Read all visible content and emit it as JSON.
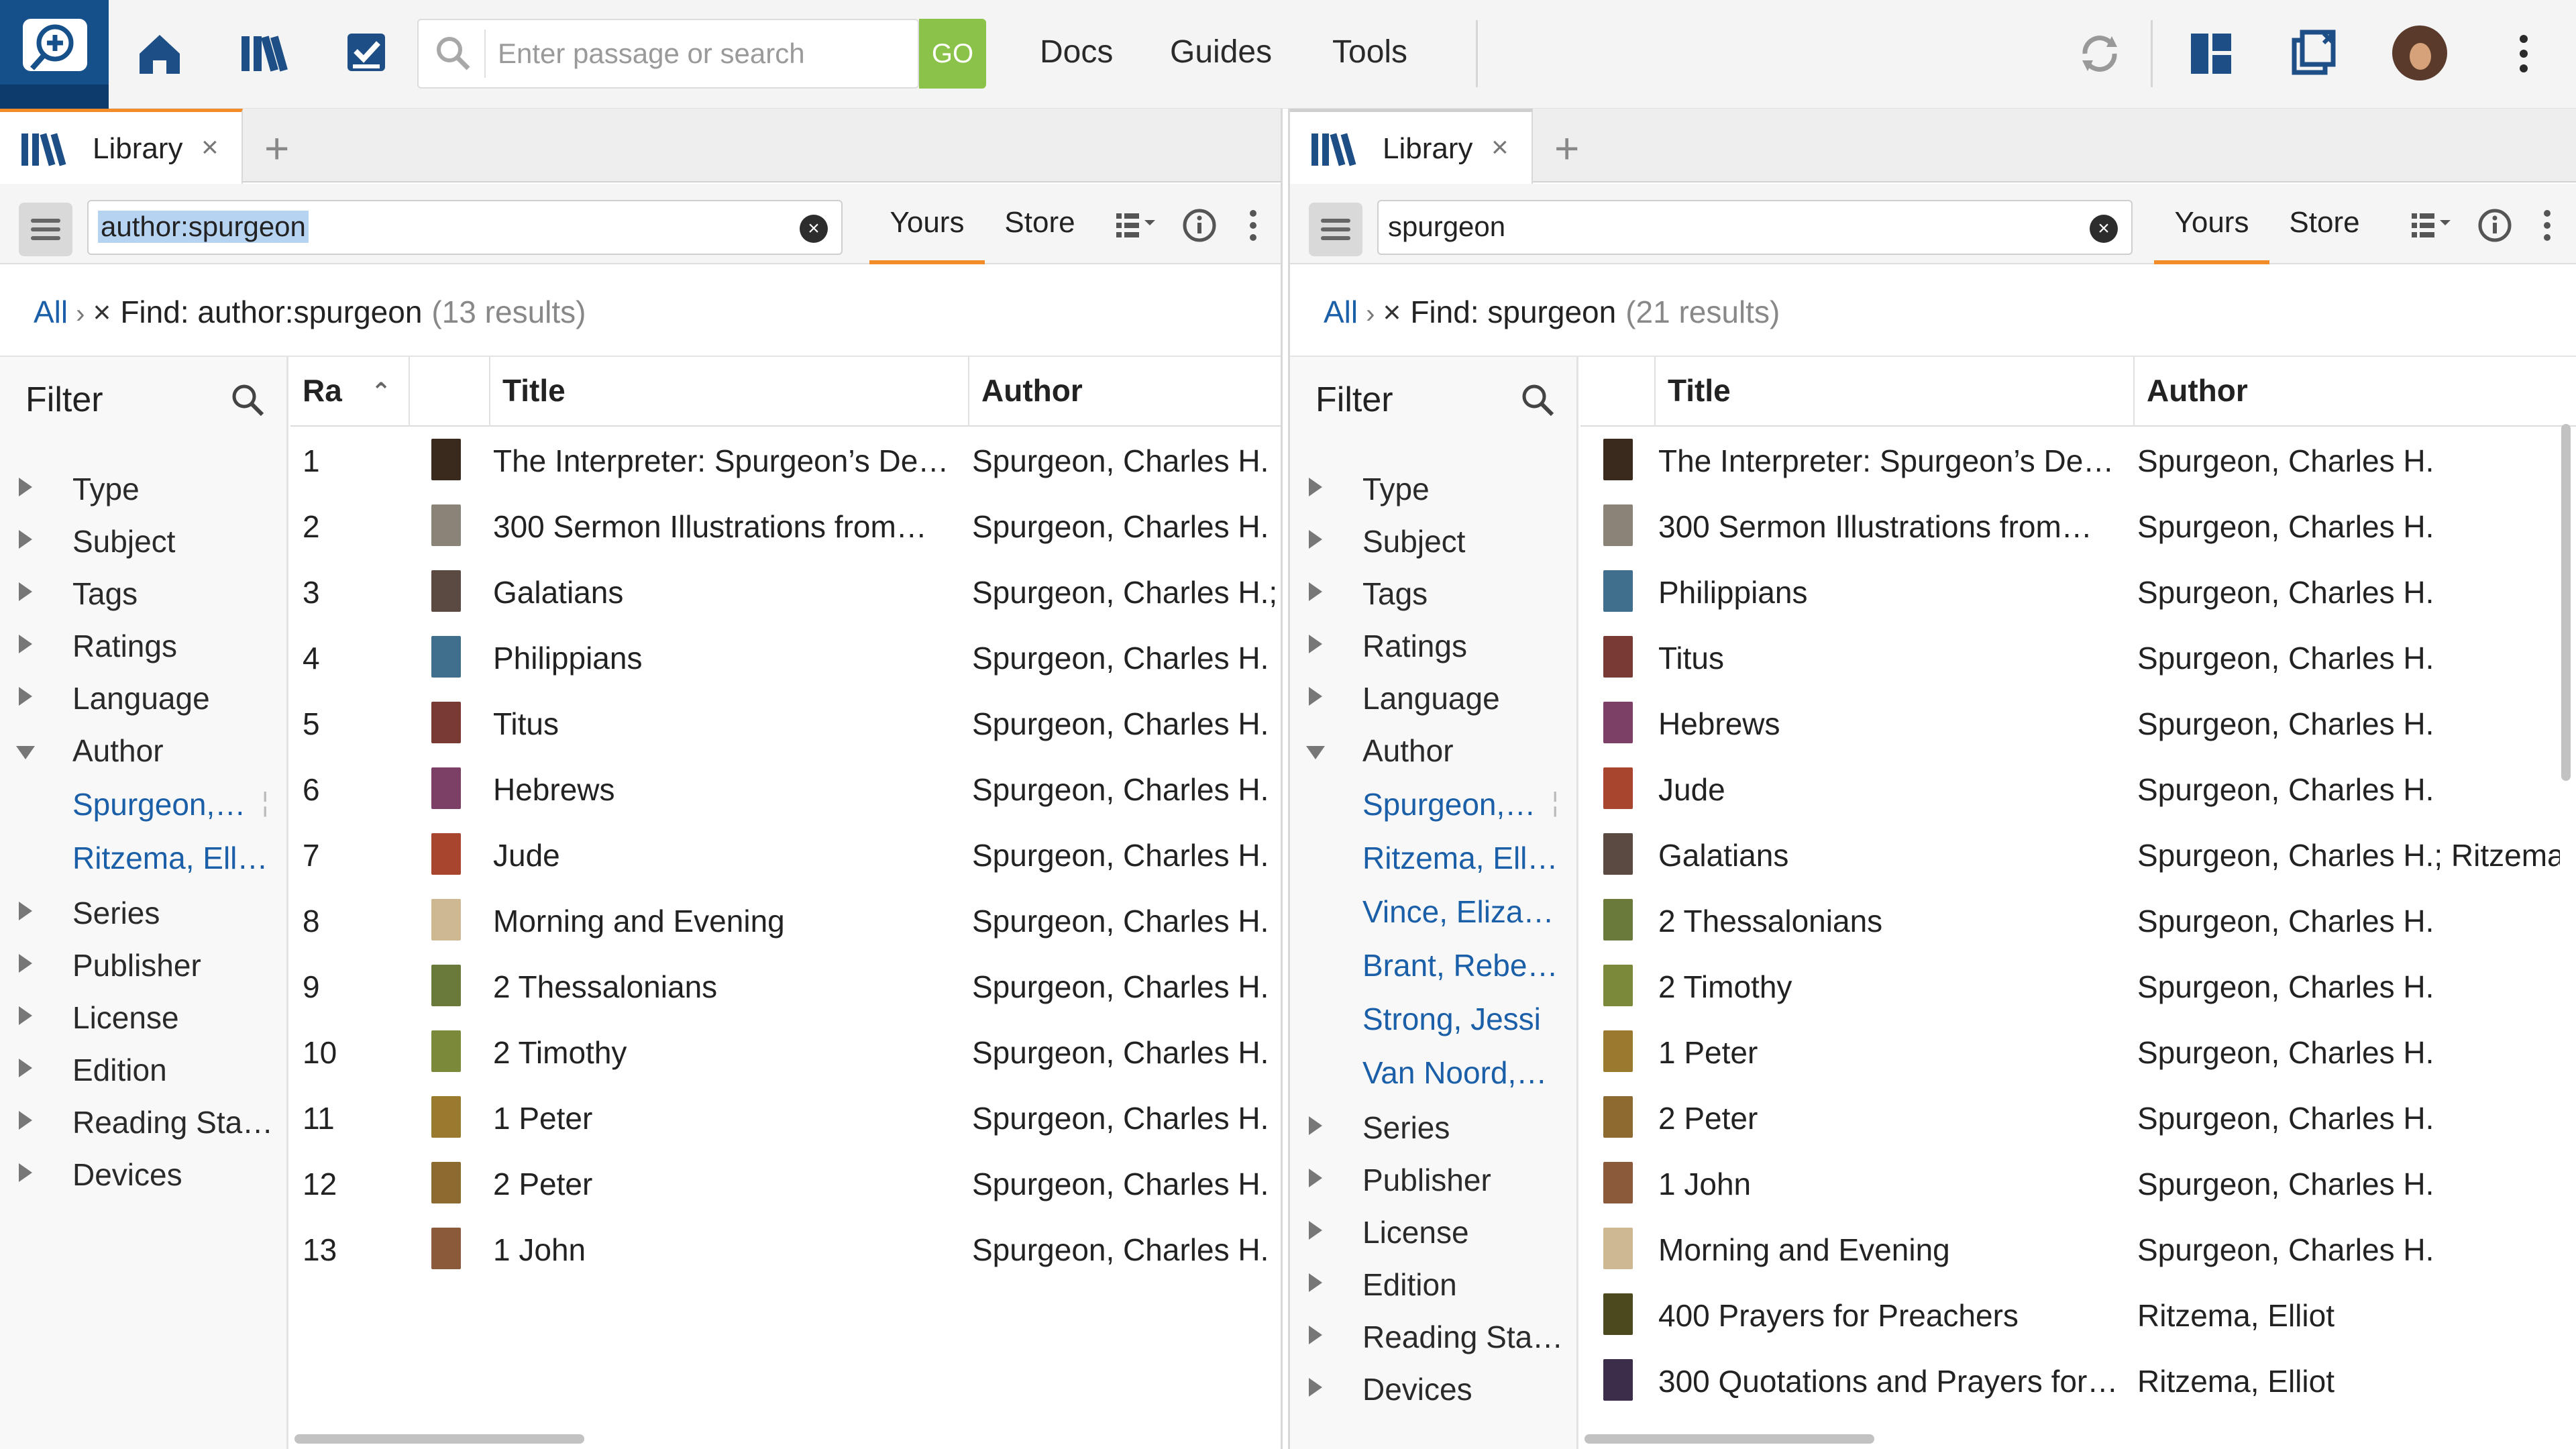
{
  "app": {
    "search_placeholder": "Enter passage or search",
    "go_label": "GO",
    "nav": [
      "Docs",
      "Guides",
      "Tools"
    ]
  },
  "left": {
    "tab_label": "Library",
    "tab_close": "×",
    "tab_add": "+",
    "filter_value": "author:spurgeon",
    "seg_yours": "Yours",
    "seg_store": "Store",
    "crumb_all": "All",
    "crumb_find": "Find: author:spurgeon",
    "crumb_count": "(13 results)",
    "filter_head": "Filter",
    "facets_top": [
      "Type",
      "Subject",
      "Tags",
      "Ratings",
      "Language"
    ],
    "facet_author": "Author",
    "author_values": [
      "Spurgeon,…",
      "Ritzema, Ell…"
    ],
    "facets_bottom": [
      "Series",
      "Publisher",
      "License",
      "Edition",
      "Reading Sta…",
      "Devices"
    ],
    "headers": {
      "rank": "Ra",
      "title": "Title",
      "author": "Author"
    },
    "rows": [
      {
        "rank": "1",
        "title": "The Interpreter: Spurgeon’s De…",
        "author": "Spurgeon, Charles H.",
        "cover": "#3a2a1e"
      },
      {
        "rank": "2",
        "title": "300 Sermon Illustrations from…",
        "author": "Spurgeon, Charles H.",
        "cover": "#8a8478"
      },
      {
        "rank": "3",
        "title": "Galatians",
        "author": "Spurgeon, Charles H.; I",
        "cover": "#5a4a42"
      },
      {
        "rank": "4",
        "title": "Philippians",
        "author": "Spurgeon, Charles H.",
        "cover": "#3f6f8c"
      },
      {
        "rank": "5",
        "title": "Titus",
        "author": "Spurgeon, Charles H.",
        "cover": "#7a3a34"
      },
      {
        "rank": "6",
        "title": "Hebrews",
        "author": "Spurgeon, Charles H.",
        "cover": "#7c3f66"
      },
      {
        "rank": "7",
        "title": "Jude",
        "author": "Spurgeon, Charles H.",
        "cover": "#a8452e"
      },
      {
        "rank": "8",
        "title": "Morning and Evening",
        "author": "Spurgeon, Charles H.",
        "cover": "#cdb892"
      },
      {
        "rank": "9",
        "title": "2 Thessalonians",
        "author": "Spurgeon, Charles H.",
        "cover": "#6a7a3a"
      },
      {
        "rank": "10",
        "title": "2 Timothy",
        "author": "Spurgeon, Charles H.",
        "cover": "#7a8a3a"
      },
      {
        "rank": "11",
        "title": "1 Peter",
        "author": "Spurgeon, Charles H.",
        "cover": "#9a7a2e"
      },
      {
        "rank": "12",
        "title": "2 Peter",
        "author": "Spurgeon, Charles H.",
        "cover": "#8c6a30"
      },
      {
        "rank": "13",
        "title": "1 John",
        "author": "Spurgeon, Charles H.",
        "cover": "#8a5a3a"
      }
    ]
  },
  "right": {
    "tab_label": "Library",
    "tab_close": "×",
    "tab_add": "+",
    "filter_value": "spurgeon",
    "seg_yours": "Yours",
    "seg_store": "Store",
    "crumb_all": "All",
    "crumb_find": "Find: spurgeon",
    "crumb_count": "(21 results)",
    "filter_head": "Filter",
    "facets_top": [
      "Type",
      "Subject",
      "Tags",
      "Ratings",
      "Language"
    ],
    "facet_author": "Author",
    "author_values": [
      "Spurgeon,…",
      "Ritzema, Ell…",
      "Vince, Eliza…",
      "Brant, Rebe…",
      "Strong, Jessi",
      "Van Noord,…"
    ],
    "facets_bottom": [
      "Series",
      "Publisher",
      "License",
      "Edition",
      "Reading Sta…",
      "Devices"
    ],
    "headers": {
      "title": "Title",
      "author": "Author"
    },
    "rows": [
      {
        "title": "The Interpreter: Spurgeon’s De…",
        "author": "Spurgeon, Charles H.",
        "cover": "#3a2a1e"
      },
      {
        "title": "300 Sermon Illustrations from…",
        "author": "Spurgeon, Charles H.",
        "cover": "#8a8478"
      },
      {
        "title": "Philippians",
        "author": "Spurgeon, Charles H.",
        "cover": "#3f6f8c"
      },
      {
        "title": "Titus",
        "author": "Spurgeon, Charles H.",
        "cover": "#7a3a34"
      },
      {
        "title": "Hebrews",
        "author": "Spurgeon, Charles H.",
        "cover": "#7c3f66"
      },
      {
        "title": "Jude",
        "author": "Spurgeon, Charles H.",
        "cover": "#a8452e"
      },
      {
        "title": "Galatians",
        "author": "Spurgeon, Charles H.; Ritzema",
        "cover": "#5a4a42"
      },
      {
        "title": "2 Thessalonians",
        "author": "Spurgeon, Charles H.",
        "cover": "#6a7a3a"
      },
      {
        "title": "2 Timothy",
        "author": "Spurgeon, Charles H.",
        "cover": "#7a8a3a"
      },
      {
        "title": "1 Peter",
        "author": "Spurgeon, Charles H.",
        "cover": "#9a7a2e"
      },
      {
        "title": "2 Peter",
        "author": "Spurgeon, Charles H.",
        "cover": "#8c6a30"
      },
      {
        "title": "1 John",
        "author": "Spurgeon, Charles H.",
        "cover": "#8a5a3a"
      },
      {
        "title": "Morning and Evening",
        "author": "Spurgeon, Charles H.",
        "cover": "#cdb892"
      },
      {
        "title": "400 Prayers for Preachers",
        "author": "Ritzema, Elliot",
        "cover": "#4a4a1e"
      },
      {
        "title": "300 Quotations and Prayers for…",
        "author": "Ritzema, Elliot",
        "cover": "#3a2e4a"
      }
    ]
  }
}
